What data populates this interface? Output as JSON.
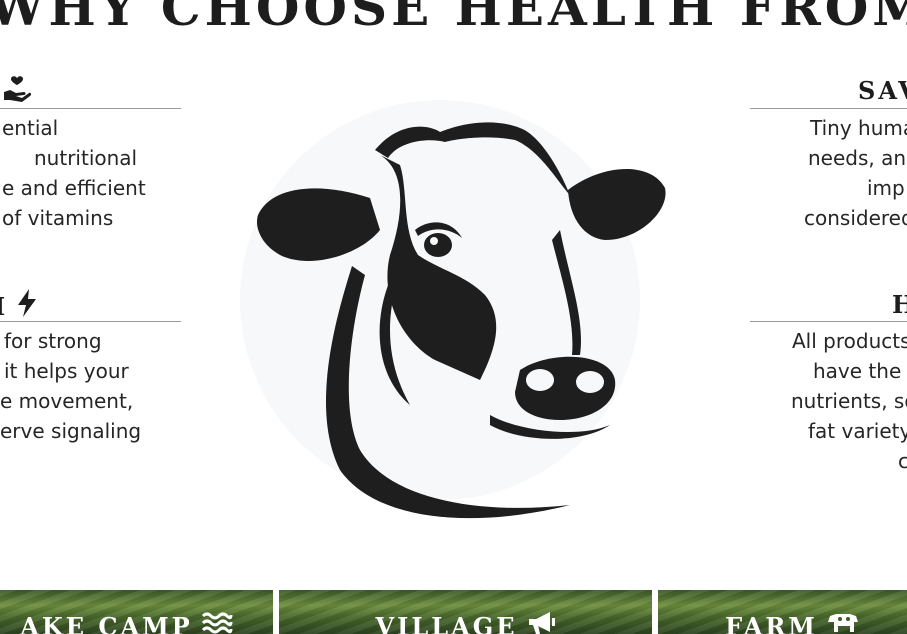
{
  "page": {
    "heading": "WHY CHOOSE HEALTH FROM"
  },
  "features": {
    "left_top": {
      "title": "",
      "icon": "hand-heart-icon",
      "lines": [
        "ential",
        "nutritional",
        "e and efficient",
        "of vitamins"
      ]
    },
    "left_bottom": {
      "title": "I",
      "icon": "bolt-icon",
      "lines": [
        "for strong",
        "it helps your",
        "e movement,",
        "erve signaling"
      ]
    },
    "right_top": {
      "title": "SAV",
      "lines": [
        "Tiny huma",
        "needs, and",
        "imp",
        "considered"
      ]
    },
    "right_bottom": {
      "title": "H",
      "lines": [
        "All products",
        "have the",
        "nutrients, so",
        "fat variety",
        "c"
      ]
    }
  },
  "cards": [
    {
      "label": "AKE CAMP",
      "icon": "water-waves-icon"
    },
    {
      "label": "VILLAGE",
      "icon": "megaphone-icon"
    },
    {
      "label": "FARM",
      "icon": "cow-icon"
    }
  ],
  "colors": {
    "text": "#222222",
    "rule": "#9a9a9a",
    "card_green": "#4a6a2c",
    "card_text": "#ffffff"
  }
}
